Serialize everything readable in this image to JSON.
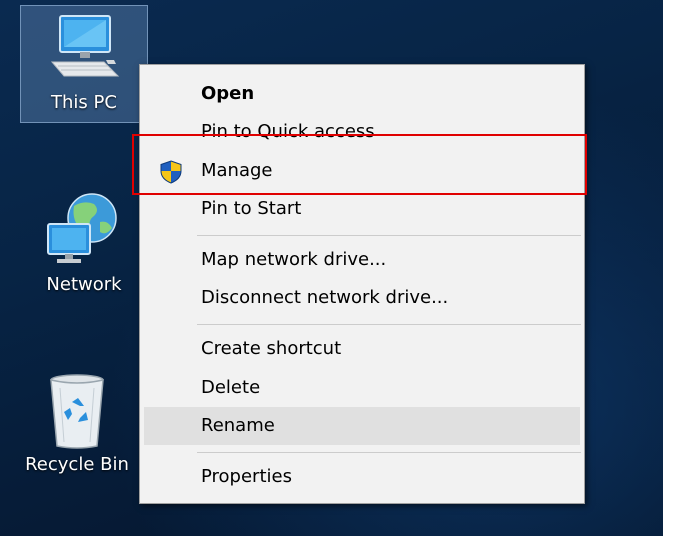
{
  "desktop": {
    "icons": [
      {
        "label": "This PC",
        "icon": "computer-icon",
        "selected": true
      },
      {
        "label": "Network",
        "icon": "network-globe-icon"
      },
      {
        "label": "Recycle Bin",
        "icon": "recycle-bin-icon"
      }
    ]
  },
  "context_menu": {
    "items": [
      {
        "label": "Open",
        "bold": true
      },
      {
        "label": "Pin to Quick access"
      },
      {
        "label": "Manage",
        "icon": "uac-shield-icon",
        "highlighted": true
      },
      {
        "label": "Pin to Start"
      },
      {
        "label": "Map network drive..."
      },
      {
        "label": "Disconnect network drive..."
      },
      {
        "label": "Create shortcut"
      },
      {
        "label": "Delete"
      },
      {
        "label": "Rename",
        "hovered": true
      },
      {
        "label": "Properties"
      }
    ]
  },
  "colors": {
    "highlight_border": "#e00000",
    "menu_background": "#f2f2f2",
    "hover_background": "#e0e0e0",
    "desktop_background": "#072445"
  }
}
